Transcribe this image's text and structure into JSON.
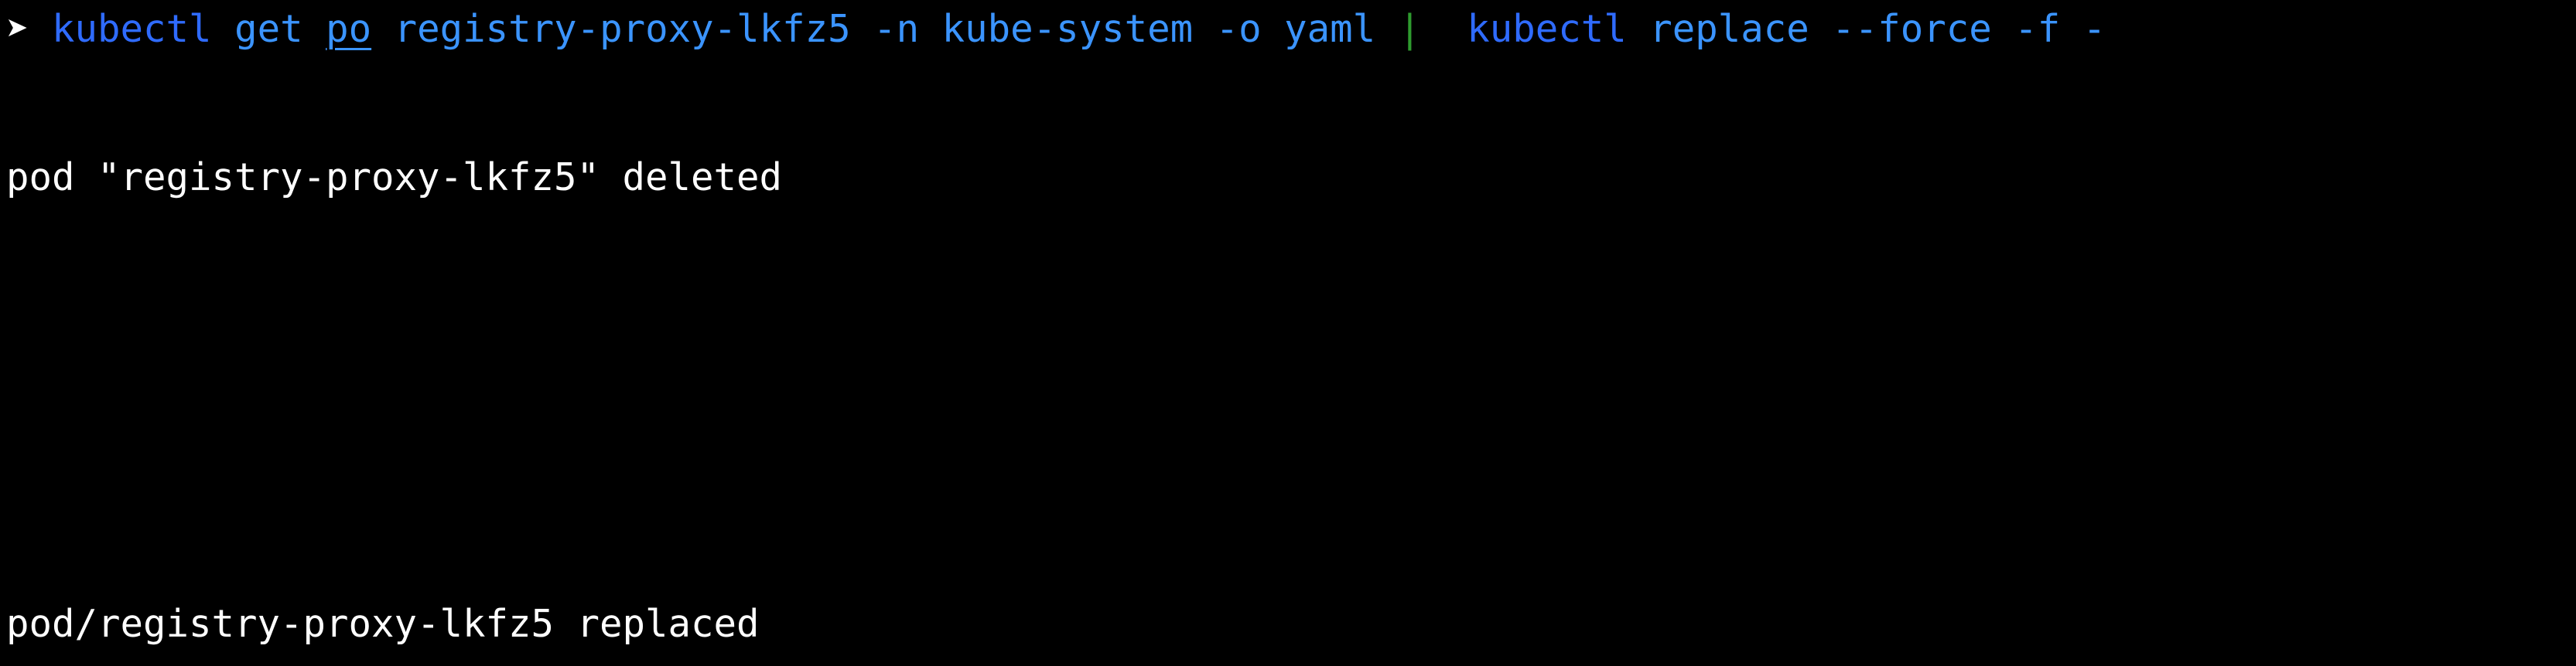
{
  "terminal": {
    "prompt": "➤",
    "command": {
      "part1_cmd": "kubectl",
      "part1_get": "get",
      "part1_resource": "po",
      "part1_args": "registry-proxy-lkfz5 -n kube-system -o yaml",
      "pipe": "|",
      "part2_cmd": "kubectl",
      "part2_args": "replace --force -f -"
    },
    "output": [
      "pod \"registry-proxy-lkfz5\" deleted",
      "pod/registry-proxy-lkfz5 replaced"
    ]
  },
  "colors": {
    "background": "#000000",
    "text": "#ffffff",
    "command": "#2f6bff",
    "argument": "#3b94ff",
    "pipe": "#2e9b2e"
  }
}
